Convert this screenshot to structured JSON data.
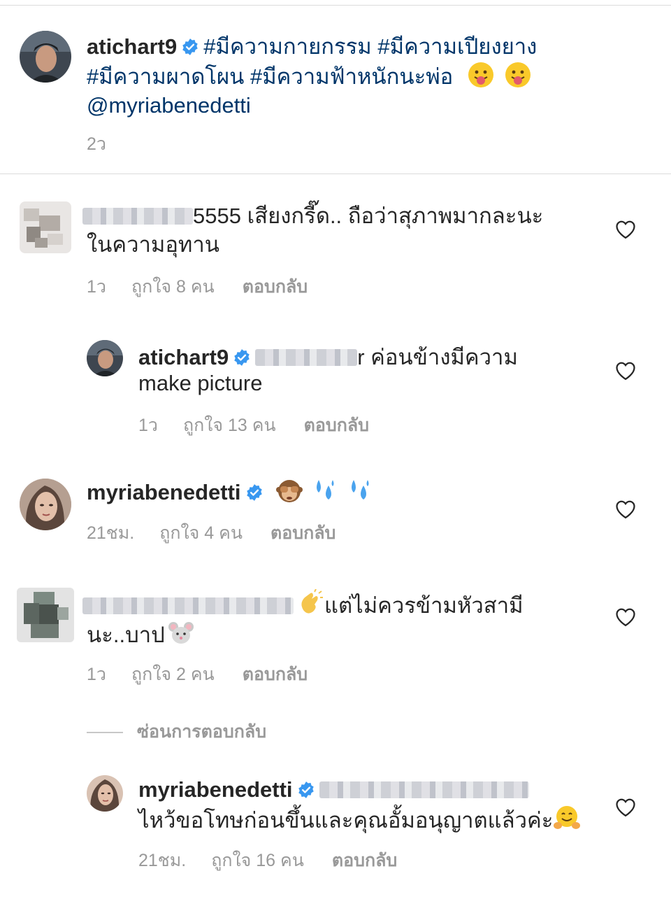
{
  "caption": {
    "username": "atichart9",
    "line1_hashtags": "#มีความกายกรรม #มีความเปียงยาง",
    "line2_hashtags": "#มีความผาดโผน #มีความฟ้าหนักนะพ่อ",
    "mention": "@myriabenedetti",
    "time": "2ว",
    "emojis": [
      "tongue-face-emoji",
      "tongue-face-emoji"
    ]
  },
  "comments": [
    {
      "username_blurred": true,
      "text_line1": "5555 เสียงกรี๊ด.. ถือว่าสุภาพมากละนะ",
      "text_line2": "ในความอุทาน",
      "time": "1ว",
      "likes": "ถูกใจ 8 คน",
      "reply_label": "ตอบกลับ"
    },
    {
      "username": "atichart9",
      "text_line1": "r ค่อนข้างมีความ",
      "text_line2": "make picture",
      "time": "1ว",
      "likes": "ถูกใจ 13 คน",
      "reply_label": "ตอบกลับ"
    },
    {
      "username": "myriabenedetti",
      "emojis": [
        "see-no-evil-monkey-emoji",
        "sweat-droplets-emoji",
        "sweat-droplets-emoji"
      ],
      "time": "21ชม.",
      "likes": "ถูกใจ 4 คน",
      "reply_label": "ตอบกลับ"
    },
    {
      "username_blurred": true,
      "text_line1": "แต่ไม่ควรข้ามหัวสามี",
      "text_line2": "นะ..บาป",
      "emojis": [
        "clapping-hands-emoji",
        "mouse-face-emoji"
      ],
      "time": "1ว",
      "likes": "ถูกใจ 2 คน",
      "reply_label": "ตอบกลับ"
    },
    {
      "username": "myriabenedetti",
      "text_line2": "ไหว้ขอโทษก่อนขึ้นและคุณอั้มอนุญาตแล้วค่ะ",
      "emojis": [
        "hugging-face-emoji"
      ],
      "time": "21ชม.",
      "likes": "ถูกใจ 16 คน",
      "reply_label": "ตอบกลับ"
    }
  ],
  "hide_replies_label": "ซ่อนการตอบกลับ",
  "colors": {
    "text": "#262626",
    "hashtag": "#003569",
    "meta": "#999999",
    "verified": "#3897f0",
    "divider": "#dbdbdb"
  }
}
